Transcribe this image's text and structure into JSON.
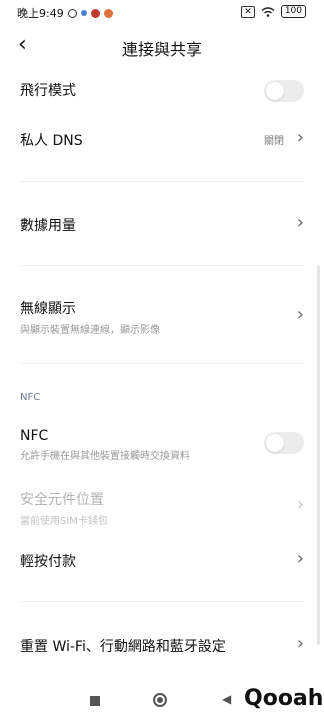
{
  "status_bar": {
    "time": "晚上9:49",
    "battery": "100"
  },
  "header": {
    "title": "連接與共享"
  },
  "rows": {
    "airplane": {
      "label": "飛行模式"
    },
    "private_dns": {
      "label": "私人 DNS",
      "value": "關閉"
    },
    "data_usage": {
      "label": "數據用量"
    },
    "wireless_display": {
      "label": "無線顯示",
      "sub": "與顯示裝置無線連線，顯示影像"
    },
    "nfc": {
      "label": "NFC",
      "sub": "允許手機在與其他裝置接觸時交換資料"
    },
    "secure_element": {
      "label": "安全元件位置",
      "sub": "當前使用SIM卡錢包"
    },
    "tap_pay": {
      "label": "輕按付款"
    },
    "reset": {
      "label": "重置 Wi-Fi、行動網路和藍牙設定"
    }
  },
  "section_nfc": {
    "title": "NFC"
  },
  "watermark": {
    "text": "Qooah"
  }
}
